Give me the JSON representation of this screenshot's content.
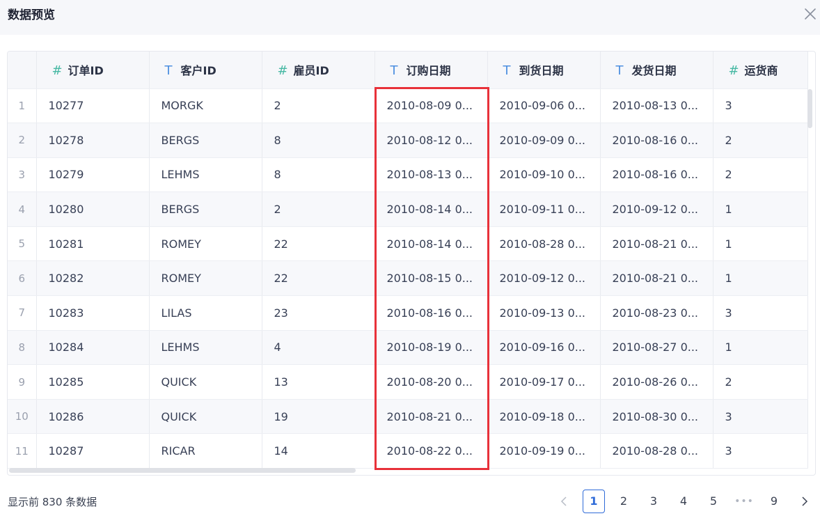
{
  "dialog": {
    "title": "数据预览"
  },
  "table": {
    "columns": [
      {
        "type_icon": "#",
        "label": "订单ID"
      },
      {
        "type_icon": "T",
        "label": "客户ID"
      },
      {
        "type_icon": "#",
        "label": "雇员ID"
      },
      {
        "type_icon": "T",
        "label": "订购日期"
      },
      {
        "type_icon": "T",
        "label": "到货日期"
      },
      {
        "type_icon": "T",
        "label": "发货日期"
      },
      {
        "type_icon": "#",
        "label": "运货商"
      }
    ],
    "rows": [
      {
        "idx": "1",
        "cells": [
          "10277",
          "MORGK",
          "2",
          "2010-08-09 0...",
          "2010-09-06 0...",
          "2010-08-13 0...",
          "3"
        ]
      },
      {
        "idx": "2",
        "cells": [
          "10278",
          "BERGS",
          "8",
          "2010-08-12 0...",
          "2010-09-09 0...",
          "2010-08-16 0...",
          "2"
        ]
      },
      {
        "idx": "3",
        "cells": [
          "10279",
          "LEHMS",
          "8",
          "2010-08-13 0...",
          "2010-09-10 0...",
          "2010-08-16 0...",
          "2"
        ]
      },
      {
        "idx": "4",
        "cells": [
          "10280",
          "BERGS",
          "2",
          "2010-08-14 0...",
          "2010-09-11 0...",
          "2010-09-12 0...",
          "1"
        ]
      },
      {
        "idx": "5",
        "cells": [
          "10281",
          "ROMEY",
          "22",
          "2010-08-14 0...",
          "2010-08-28 0...",
          "2010-08-21 0...",
          "1"
        ]
      },
      {
        "idx": "6",
        "cells": [
          "10282",
          "ROMEY",
          "22",
          "2010-08-15 0...",
          "2010-09-12 0...",
          "2010-08-21 0...",
          "1"
        ]
      },
      {
        "idx": "7",
        "cells": [
          "10283",
          "LILAS",
          "23",
          "2010-08-16 0...",
          "2010-09-13 0...",
          "2010-08-23 0...",
          "3"
        ]
      },
      {
        "idx": "8",
        "cells": [
          "10284",
          "LEHMS",
          "4",
          "2010-08-19 0...",
          "2010-09-16 0...",
          "2010-08-27 0...",
          "1"
        ]
      },
      {
        "idx": "9",
        "cells": [
          "10285",
          "QUICK",
          "13",
          "2010-08-20 0...",
          "2010-09-17 0...",
          "2010-08-26 0...",
          "2"
        ]
      },
      {
        "idx": "10",
        "cells": [
          "10286",
          "QUICK",
          "19",
          "2010-08-21 0...",
          "2010-09-18 0...",
          "2010-08-30 0...",
          "3"
        ]
      },
      {
        "idx": "11",
        "cells": [
          "10287",
          "RICAR",
          "14",
          "2010-08-22 0...",
          "2010-09-19 0...",
          "2010-08-28 0...",
          "3"
        ]
      }
    ]
  },
  "footer": {
    "info": "显示前 830 条数据",
    "pages": [
      "1",
      "2",
      "3",
      "4",
      "5",
      "9"
    ],
    "ellipsis": "•••",
    "current_page": "1"
  },
  "icons": {
    "close": "close-icon",
    "prev": "chevron-left-icon",
    "next": "chevron-right-icon"
  },
  "colors": {
    "highlight": "#e8313a",
    "accent": "#2f6bd8",
    "number_type": "#46b8a3",
    "text_type": "#4d8fe0"
  }
}
